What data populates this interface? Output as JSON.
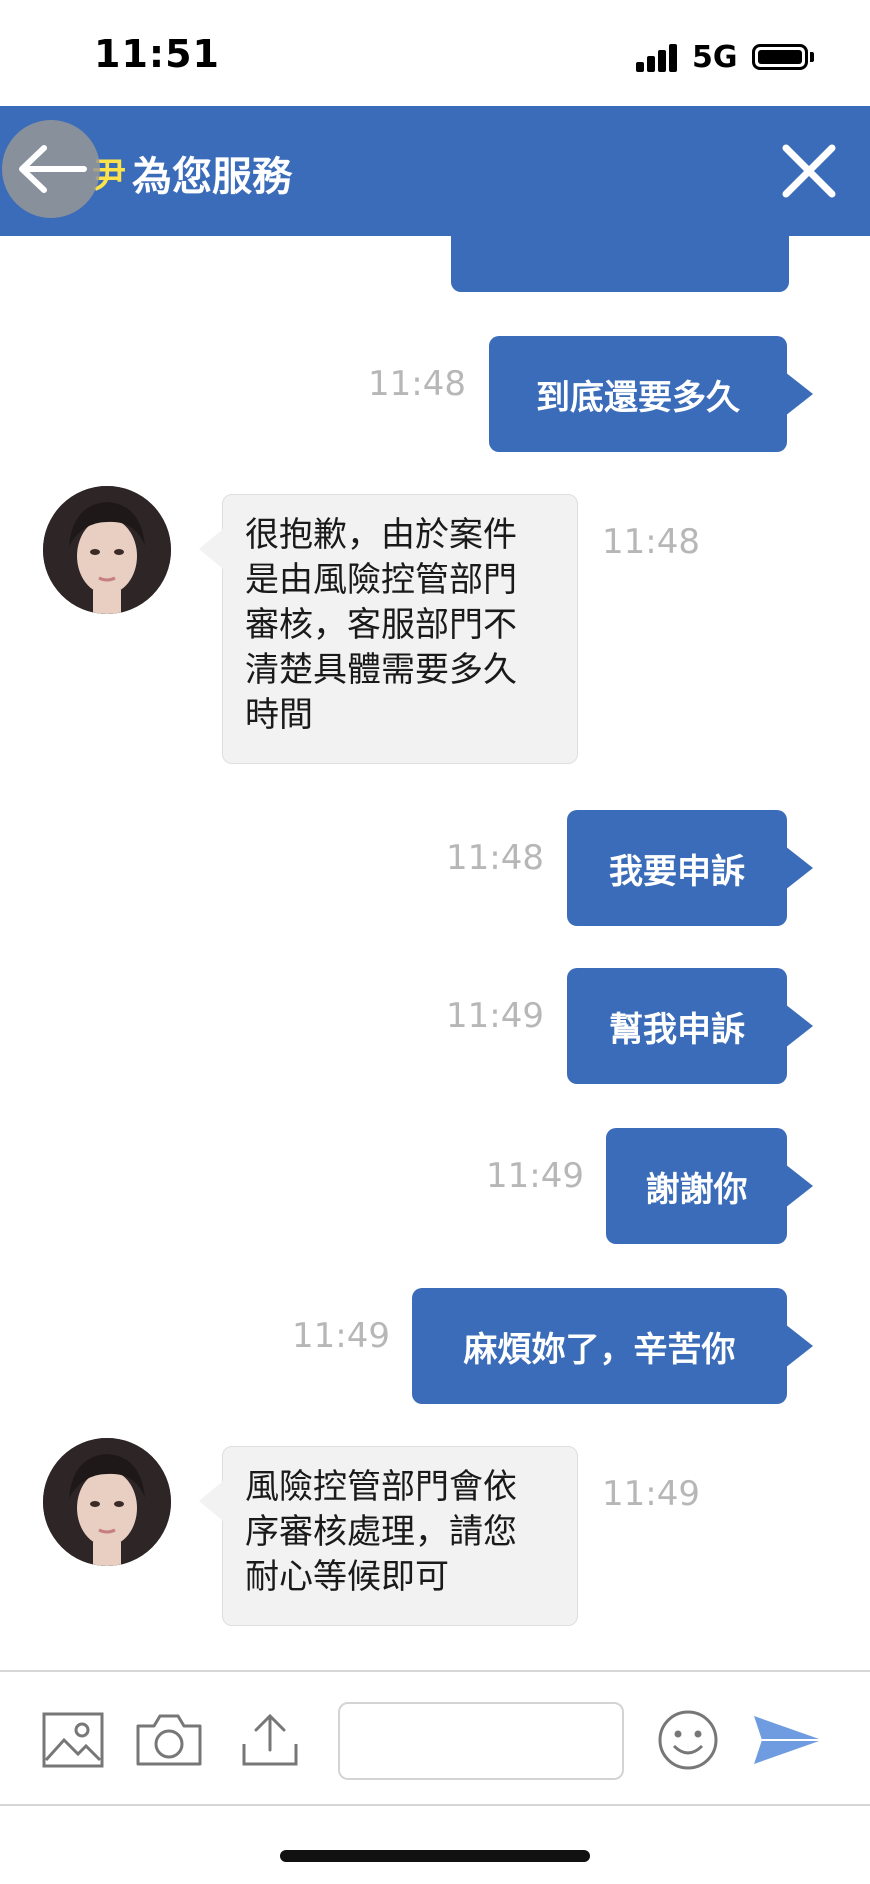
{
  "status_bar": {
    "time": "11:51",
    "network": "5G",
    "icons": [
      "signal-icon",
      "battery-icon"
    ]
  },
  "header": {
    "title": "為您服務",
    "title_prefix": "尹",
    "back_icon": "arrow-left-icon",
    "close_icon": "close-icon",
    "color": "#3b6cb9"
  },
  "messages": [
    {
      "side": "out",
      "text": "到底還要多久",
      "time": "11:48"
    },
    {
      "side": "in",
      "lines": [
        "很抱歉，由於案件",
        "是由風險控管部門",
        "審核，客服部門不",
        "清楚具體需要多久",
        "時間"
      ],
      "time": "11:48"
    },
    {
      "side": "out",
      "text": "我要申訴",
      "time": "11:48"
    },
    {
      "side": "out",
      "text": "幫我申訴",
      "time": "11:49"
    },
    {
      "side": "out",
      "text": "謝謝你",
      "time": "11:49"
    },
    {
      "side": "out",
      "text": "麻煩妳了，辛苦你",
      "time": "11:49"
    },
    {
      "side": "in",
      "lines": [
        "風險控管部門會依",
        "序審核處理，請您",
        "耐心等候即可"
      ],
      "time": "11:49"
    }
  ],
  "input_bar": {
    "icons": [
      "image-icon",
      "camera-icon",
      "upload-icon",
      "emoji-icon",
      "send-icon"
    ],
    "placeholder": ""
  },
  "colors": {
    "outgoing_bubble": "#3b6cb9",
    "incoming_bubble": "#f2f2f2",
    "timestamp": "#b7b7b7"
  }
}
